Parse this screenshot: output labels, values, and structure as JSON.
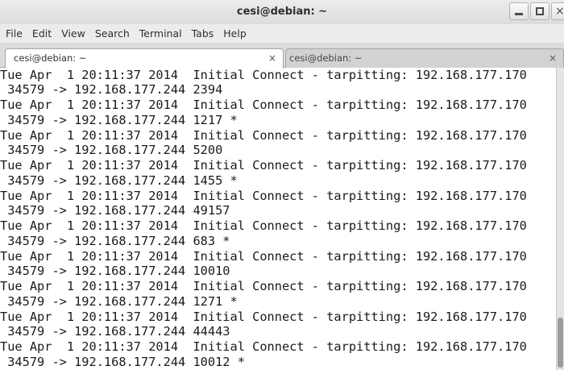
{
  "window": {
    "title": "cesi@debian: ~",
    "controls": {
      "close_glyph": "×"
    }
  },
  "menu": [
    "File",
    "Edit",
    "View",
    "Search",
    "Terminal",
    "Tabs",
    "Help"
  ],
  "tabs": [
    {
      "label": "cesi@debian: ~",
      "active": true,
      "close_glyph": "×"
    },
    {
      "label": "cesi@debian: ~",
      "active": false,
      "close_glyph": "×"
    }
  ],
  "terminal": {
    "lines": [
      "Tue Apr  1 20:11:37 2014  Initial Connect - tarpitting: 192.168.177.170",
      " 34579 -> 192.168.177.244 2394",
      "Tue Apr  1 20:11:37 2014  Initial Connect - tarpitting: 192.168.177.170",
      " 34579 -> 192.168.177.244 1217 *",
      "Tue Apr  1 20:11:37 2014  Initial Connect - tarpitting: 192.168.177.170",
      " 34579 -> 192.168.177.244 5200",
      "Tue Apr  1 20:11:37 2014  Initial Connect - tarpitting: 192.168.177.170",
      " 34579 -> 192.168.177.244 1455 *",
      "Tue Apr  1 20:11:37 2014  Initial Connect - tarpitting: 192.168.177.170",
      " 34579 -> 192.168.177.244 49157",
      "Tue Apr  1 20:11:37 2014  Initial Connect - tarpitting: 192.168.177.170",
      " 34579 -> 192.168.177.244 683 *",
      "Tue Apr  1 20:11:37 2014  Initial Connect - tarpitting: 192.168.177.170",
      " 34579 -> 192.168.177.244 10010",
      "Tue Apr  1 20:11:37 2014  Initial Connect - tarpitting: 192.168.177.170",
      " 34579 -> 192.168.177.244 1271 *",
      "Tue Apr  1 20:11:37 2014  Initial Connect - tarpitting: 192.168.177.170",
      " 34579 -> 192.168.177.244 44443",
      "Tue Apr  1 20:11:37 2014  Initial Connect - tarpitting: 192.168.177.170",
      " 34579 -> 192.168.177.244 10012 *"
    ]
  },
  "colors": {
    "terminal_background": "#ffffff",
    "terminal_text": "#1a1a1a",
    "chrome": "#ececec"
  }
}
